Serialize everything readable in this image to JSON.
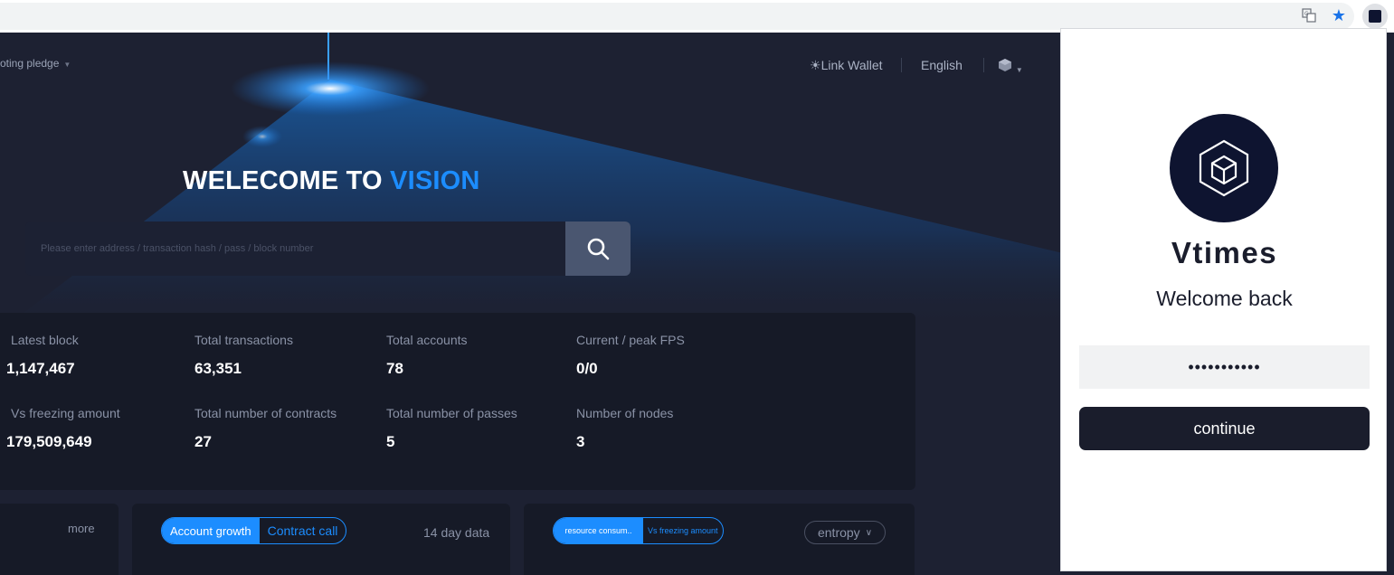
{
  "browser": {
    "translate_icon": "translate-icon",
    "bookmark_icon": "star-icon",
    "extension_icon": "vtimes-extension-icon"
  },
  "nav": {
    "voting_pledge": "oting pledge",
    "link_wallet": "Link Wallet",
    "language": "English",
    "network_icon": "cube-icon"
  },
  "hero": {
    "title_prefix": "WELECOME TO",
    "title_accent": "VISION",
    "accent_color": "#1c8dff"
  },
  "search": {
    "placeholder": "Please enter address / transaction hash / pass / block number",
    "button_icon": "search-icon"
  },
  "stats": [
    {
      "label": "Latest block",
      "value": "1,147,467"
    },
    {
      "label": "Total transactions",
      "value": "63,351"
    },
    {
      "label": "Total accounts",
      "value": "78"
    },
    {
      "label": "Current / peak FPS",
      "value": "0/0"
    },
    {
      "label": "Vs freezing amount",
      "value": "179,509,649"
    },
    {
      "label": "Total number of contracts",
      "value": "27"
    },
    {
      "label": "Total number of passes",
      "value": "5"
    },
    {
      "label": "Number of nodes",
      "value": "3"
    }
  ],
  "cards": {
    "more": "more",
    "growth_toggle": [
      "Account growth",
      "Contract call"
    ],
    "days_label": "14 day data",
    "resource_toggle": [
      "resource consum..",
      "Vs freezing amount"
    ],
    "entropy_select": "entropy"
  },
  "popup": {
    "brand": "Vtimes",
    "welcome": "Welcome back",
    "password_value": "•••••••••••",
    "continue_label": "continue"
  }
}
